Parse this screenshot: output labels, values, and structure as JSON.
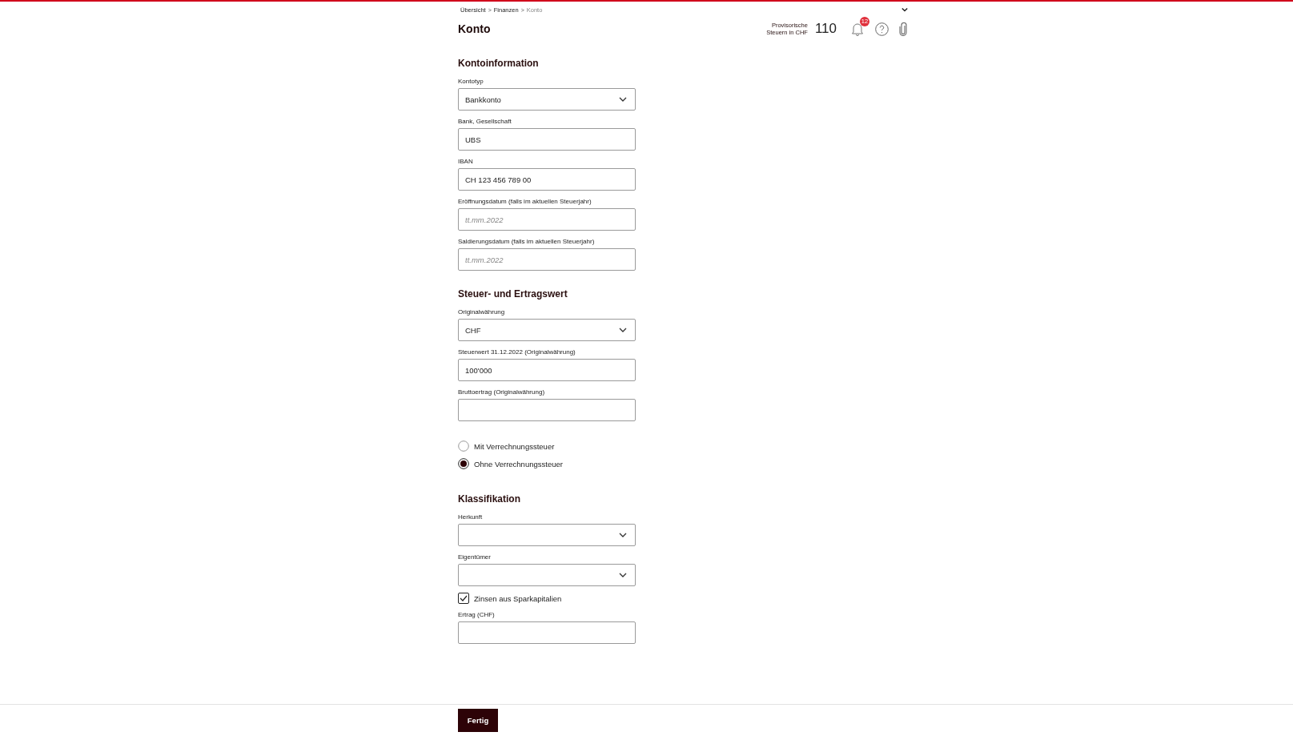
{
  "breadcrumb": [
    {
      "label": "Übersicht",
      "current": false
    },
    {
      "label": "Finanzen",
      "current": false
    },
    {
      "label": "Konto",
      "current": true
    }
  ],
  "breadcrumb_separator": ">",
  "title": "Konto",
  "tax_estimate": {
    "label_line1": "Provisorische",
    "label_line2": "Steuern in CHF",
    "value": "110"
  },
  "notifications": {
    "badge": "12"
  },
  "sections": [
    {
      "heading": "Kontoinformation",
      "items": [
        {
          "kind": "select",
          "label": "Kontotyp",
          "value": "Bankkonto"
        },
        {
          "kind": "text",
          "label": "Bank, Gesellschaft",
          "value": "UBS"
        },
        {
          "kind": "text",
          "label": "IBAN",
          "value": "CH 123 456 789 00"
        },
        {
          "kind": "text",
          "label": "Eröffnungsdatum (falls im aktuellen Steuerjahr)",
          "placeholder": "tt.mm.2022"
        },
        {
          "kind": "text",
          "label": "Saldierungsdatum (falls im aktuellen Steuerjahr)",
          "placeholder": "tt.mm.2022"
        }
      ]
    },
    {
      "heading": "Steuer- und Ertragswert",
      "items": [
        {
          "kind": "select",
          "label": "Originalwährung",
          "value": "CHF"
        },
        {
          "kind": "text",
          "label": "Steuerwert 31.12.2022 (Originalwährung)",
          "value": "100'000"
        },
        {
          "kind": "text",
          "label": "Bruttoertrag (Originalwährung)"
        },
        {
          "kind": "radio",
          "label": "Mit Verrechnungssteuer",
          "selected": false
        },
        {
          "kind": "radio",
          "label": "Ohne Verrechnungssteuer",
          "selected": true
        }
      ]
    },
    {
      "heading": "Klassifikation",
      "items": [
        {
          "kind": "select",
          "label": "Herkunft"
        },
        {
          "kind": "select",
          "label": "Eigentümer"
        },
        {
          "kind": "checkbox",
          "label": "Zinsen aus Sparkapitalien",
          "checked": true
        },
        {
          "kind": "text",
          "label": "Ertrag (CHF)"
        }
      ]
    }
  ],
  "done_button": "Fertig"
}
